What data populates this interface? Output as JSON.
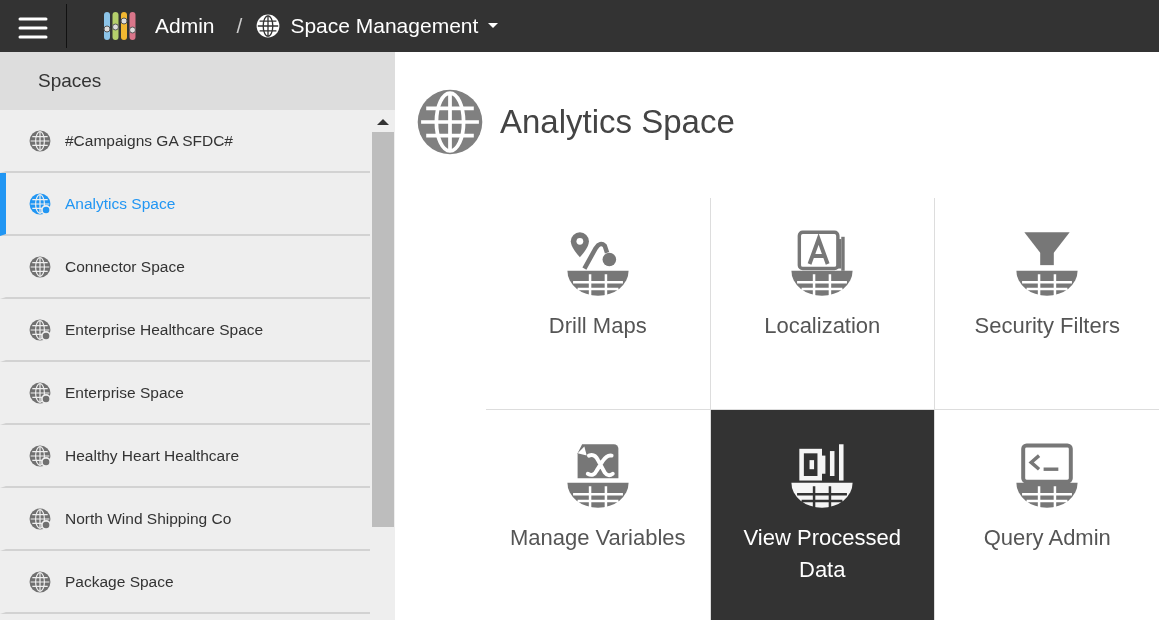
{
  "topbar": {
    "app_title": "Admin",
    "separator": "/",
    "section": "Space Management"
  },
  "sidebar": {
    "title": "Spaces",
    "items": [
      {
        "label": "#Campaigns GA SFDC#",
        "kind": "globe",
        "selected": false
      },
      {
        "label": "Analytics Space",
        "kind": "globe-dot",
        "selected": true
      },
      {
        "label": "Connector Space",
        "kind": "globe",
        "selected": false
      },
      {
        "label": "Enterprise Healthcare Space",
        "kind": "globe-dot",
        "selected": false
      },
      {
        "label": "Enterprise Space",
        "kind": "globe-dot",
        "selected": false
      },
      {
        "label": "Healthy Heart Healthcare",
        "kind": "globe-dot",
        "selected": false
      },
      {
        "label": "North Wind Shipping Co",
        "kind": "globe-dot",
        "selected": false
      },
      {
        "label": "Package Space",
        "kind": "globe",
        "selected": false
      }
    ]
  },
  "main": {
    "title": "Analytics Space",
    "tiles": [
      {
        "label": "Drill Maps",
        "kind": "drill-map",
        "selected": false
      },
      {
        "label": "Localization",
        "kind": "localization",
        "selected": false
      },
      {
        "label": "Security Filters",
        "kind": "filter",
        "selected": false
      },
      {
        "label": "Manage Variables",
        "kind": "variable",
        "selected": false
      },
      {
        "label": "View Processed Data",
        "kind": "data",
        "selected": true
      },
      {
        "label": "Query Admin",
        "kind": "query",
        "selected": false
      }
    ]
  }
}
